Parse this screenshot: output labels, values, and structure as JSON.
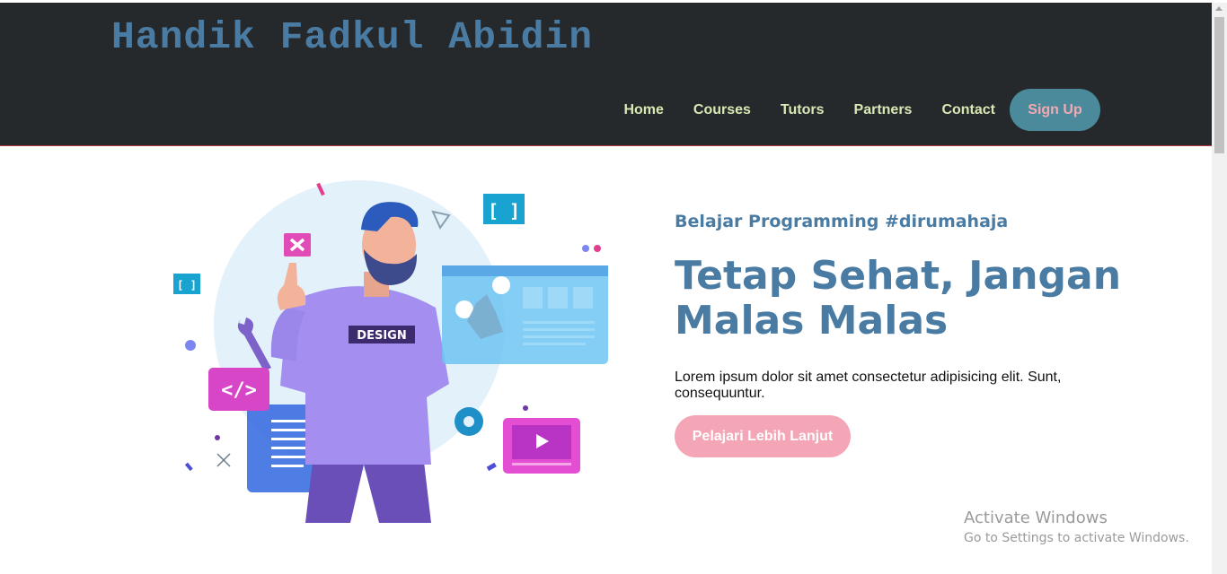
{
  "header": {
    "brand": "Handik Fadkul Abidin",
    "nav": [
      "Home",
      "Courses",
      "Tutors",
      "Partners",
      "Contact"
    ],
    "signup_label": "Sign Up"
  },
  "hero": {
    "subtitle": "Belajar Programming #dirumahaja",
    "title": "Tetap Sehat, Jangan Malas Malas",
    "description": "Lorem ipsum dolor sit amet consectetur adipisicing elit. Sunt, consequuntur.",
    "cta_label": "Pelajari Lebih Lanjut",
    "illustration_badge": "DESIGN"
  },
  "watermark": {
    "line1": "Activate Windows",
    "line2": "Go to Settings to activate Windows."
  },
  "colors": {
    "navbar_bg": "#26292b",
    "brand": "#4a7ba3",
    "nav_link": "#d7e8b4",
    "signup_bg": "#4a8a9a",
    "signup_text": "#f1a9b3",
    "cta_bg": "#f4a6b6"
  }
}
